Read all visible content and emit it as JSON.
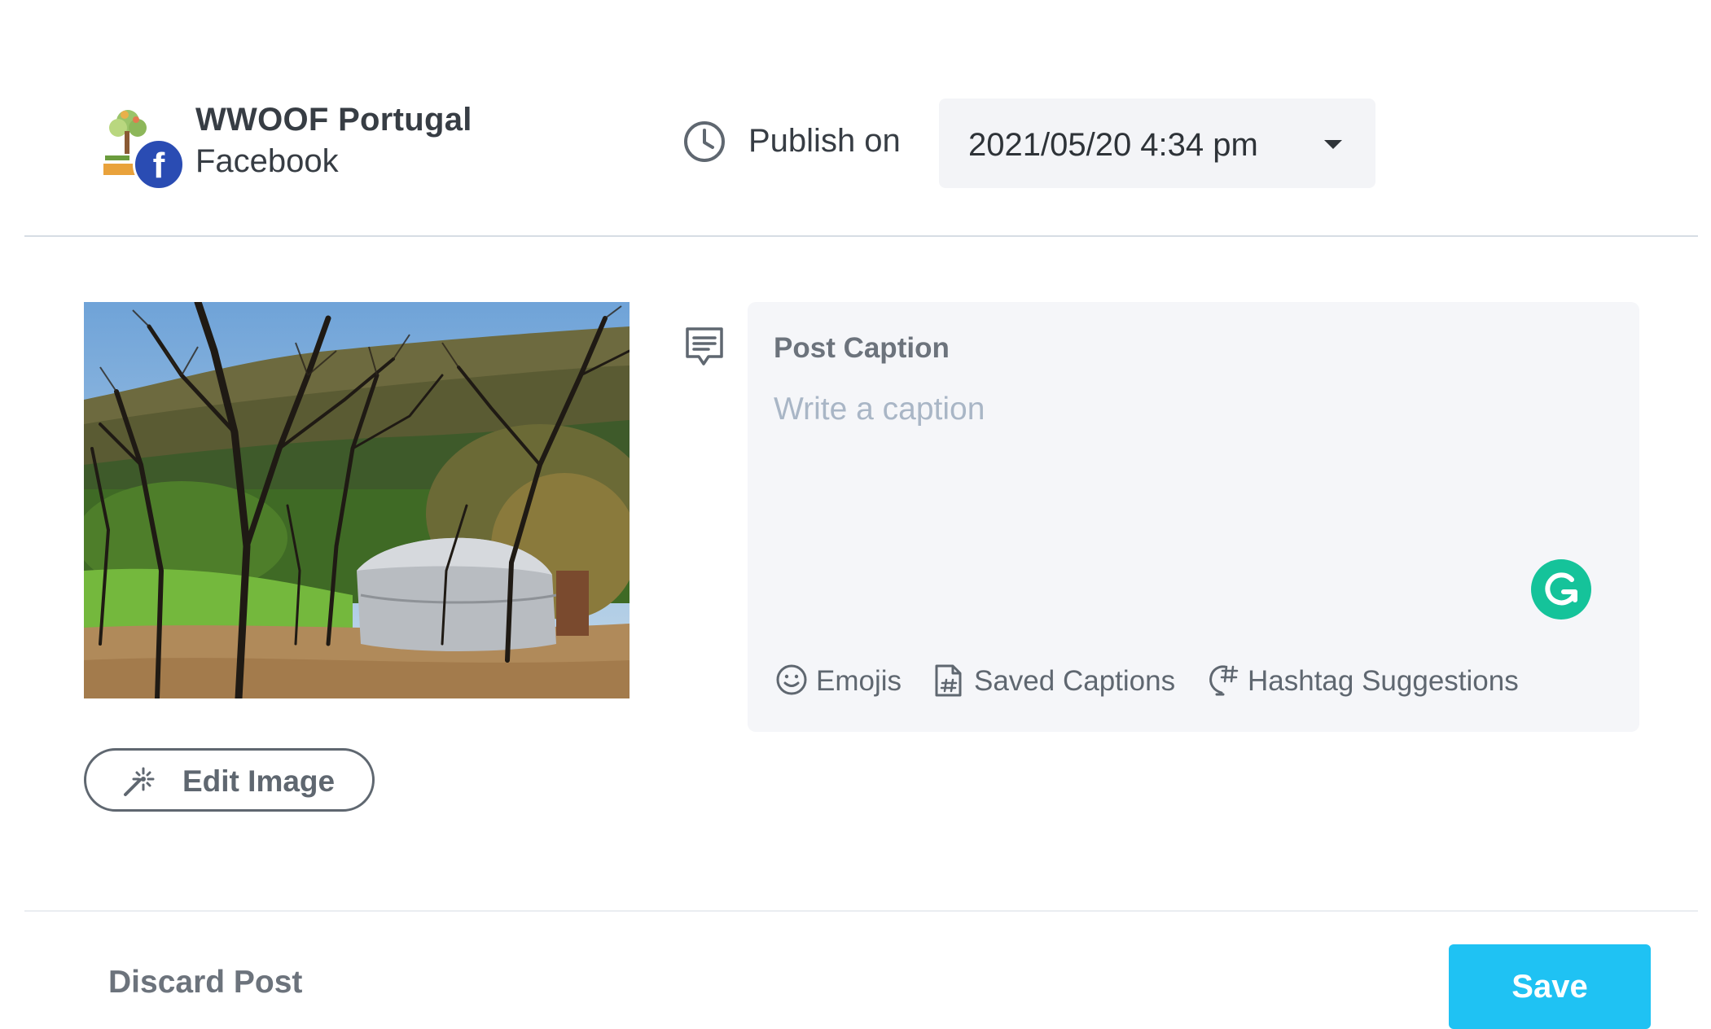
{
  "header": {
    "account_name": "WWOOF Portugal",
    "account_network": "Facebook",
    "avatar_icon": "wwoof-tree-logo",
    "network_badge_icon": "facebook-icon",
    "network_badge_letter": "f",
    "network_color": "#2a4cb3",
    "publish_label": "Publish on",
    "publish_icon": "clock-icon",
    "publish_datetime": "2021/05/20 4:34 pm"
  },
  "media": {
    "image_description_icon": "yurt-landscape-photo",
    "edit_image_label": "Edit Image",
    "edit_image_icon": "magic-wand-icon"
  },
  "caption": {
    "icon": "comment-icon",
    "title": "Post Caption",
    "placeholder": "Write a caption",
    "value": "",
    "grammarly_icon": "grammarly-icon",
    "tools": [
      {
        "icon": "emoji-icon",
        "label": "Emojis"
      },
      {
        "icon": "saved-captions-icon",
        "label": "Saved Captions"
      },
      {
        "icon": "hashtag-suggestions-icon",
        "label": "Hashtag Suggestions"
      }
    ]
  },
  "footer": {
    "discard_label": "Discard Post",
    "save_label": "Save",
    "save_color": "#1fc2f3"
  }
}
